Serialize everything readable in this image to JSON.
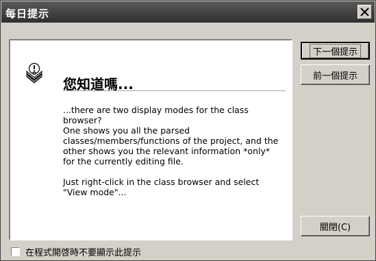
{
  "window": {
    "title": "每日提示"
  },
  "tip": {
    "heading": "您知道嗎...",
    "body": "...there are two display modes for the class browser?\nOne shows you all the parsed classes/members/functions of the project, and the other shows you the relevant information *only* for the currently editing file.\n\nJust right-click in the class browser and select \"View mode\"..."
  },
  "buttons": {
    "next_label": "下一個提示",
    "previous_label": "前一個提示",
    "close_label": "關閉(C)"
  },
  "options": {
    "dont_show_label": "在程式開啓時不要顯示此提示",
    "dont_show_checked": false
  },
  "icons": {
    "close": "close-icon",
    "tip": "lightbulb-icon"
  }
}
